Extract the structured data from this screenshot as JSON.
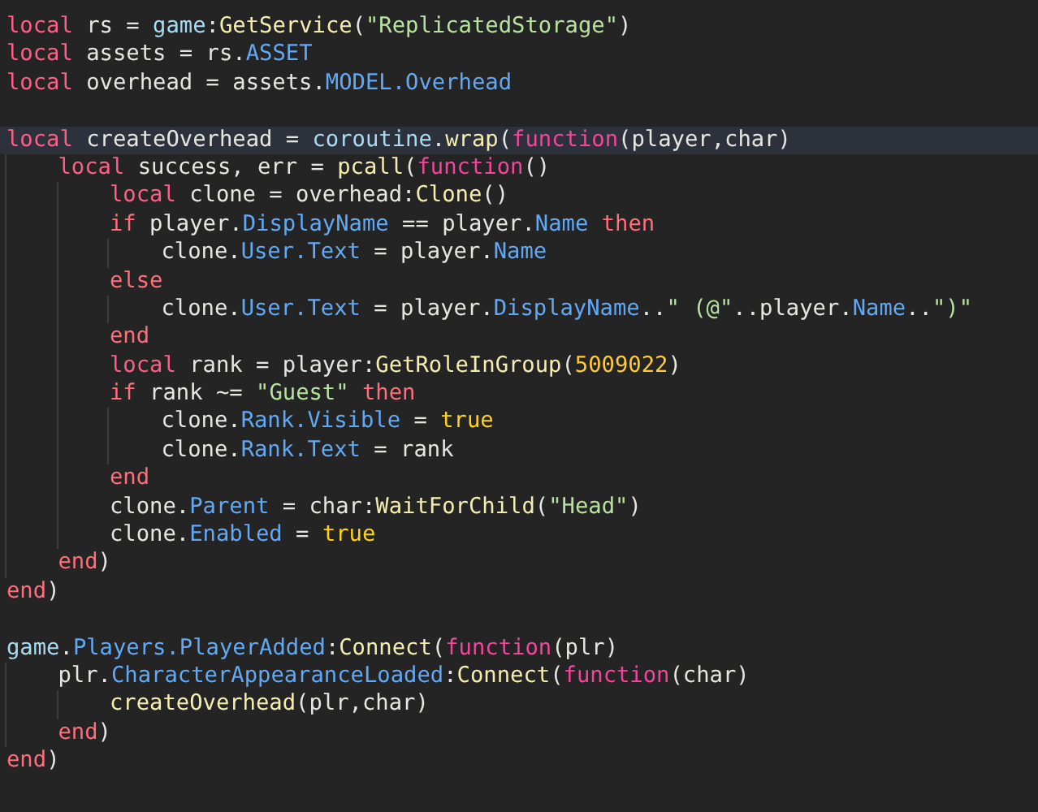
{
  "editor": {
    "lines": [
      {
        "kind": "code",
        "current": false,
        "tokens": [
          {
            "kind": "keyword",
            "text": "local"
          },
          {
            "kind": "plain",
            "text": " rs = "
          },
          {
            "kind": "global",
            "text": "game"
          },
          {
            "kind": "plain",
            "text": ":"
          },
          {
            "kind": "method",
            "text": "GetService"
          },
          {
            "kind": "plain",
            "text": "("
          },
          {
            "kind": "string",
            "text": "\"ReplicatedStorage\""
          },
          {
            "kind": "plain",
            "text": ")"
          }
        ]
      },
      {
        "kind": "code",
        "current": false,
        "tokens": [
          {
            "kind": "keyword",
            "text": "local"
          },
          {
            "kind": "plain",
            "text": " assets = rs."
          },
          {
            "kind": "property",
            "text": "ASSET"
          }
        ]
      },
      {
        "kind": "code",
        "current": false,
        "tokens": [
          {
            "kind": "keyword",
            "text": "local"
          },
          {
            "kind": "plain",
            "text": " overhead = assets."
          },
          {
            "kind": "property",
            "text": "MODEL.Overhead"
          }
        ]
      },
      {
        "kind": "blank",
        "current": false
      },
      {
        "kind": "code",
        "current": true,
        "tokens": [
          {
            "kind": "keyword",
            "text": "local"
          },
          {
            "kind": "plain",
            "text": " createOverhead = "
          },
          {
            "kind": "global",
            "text": "coroutine"
          },
          {
            "kind": "plain",
            "text": "."
          },
          {
            "kind": "method",
            "text": "wrap"
          },
          {
            "kind": "plain",
            "text": "("
          },
          {
            "kind": "function",
            "text": "function"
          },
          {
            "kind": "plain",
            "text": "(player,char)"
          }
        ],
        "children": [
          {
            "kind": "code",
            "current": false,
            "tokens": [
              {
                "kind": "keyword",
                "text": "local"
              },
              {
                "kind": "plain",
                "text": " success, err = "
              },
              {
                "kind": "method",
                "text": "pcall"
              },
              {
                "kind": "plain",
                "text": "("
              },
              {
                "kind": "function",
                "text": "function"
              },
              {
                "kind": "plain",
                "text": "()"
              }
            ],
            "children": [
              {
                "kind": "code",
                "current": false,
                "tokens": [
                  {
                    "kind": "keyword",
                    "text": "local"
                  },
                  {
                    "kind": "plain",
                    "text": " clone = overhead:"
                  },
                  {
                    "kind": "method",
                    "text": "Clone"
                  },
                  {
                    "kind": "plain",
                    "text": "()"
                  }
                ]
              },
              {
                "kind": "code",
                "current": false,
                "tokens": [
                  {
                    "kind": "control",
                    "text": "if"
                  },
                  {
                    "kind": "plain",
                    "text": " player."
                  },
                  {
                    "kind": "property",
                    "text": "DisplayName"
                  },
                  {
                    "kind": "plain",
                    "text": " == player."
                  },
                  {
                    "kind": "property",
                    "text": "Name"
                  },
                  {
                    "kind": "control",
                    "text": " then"
                  }
                ],
                "children": [
                  {
                    "kind": "code",
                    "current": false,
                    "tokens": [
                      {
                        "kind": "plain",
                        "text": "clone."
                      },
                      {
                        "kind": "property",
                        "text": "User.Text"
                      },
                      {
                        "kind": "plain",
                        "text": " = player."
                      },
                      {
                        "kind": "property",
                        "text": "Name"
                      }
                    ]
                  }
                ]
              },
              {
                "kind": "code",
                "current": false,
                "tokens": [
                  {
                    "kind": "control",
                    "text": "else"
                  }
                ],
                "children": [
                  {
                    "kind": "code",
                    "current": false,
                    "tokens": [
                      {
                        "kind": "plain",
                        "text": "clone."
                      },
                      {
                        "kind": "property",
                        "text": "User.Text"
                      },
                      {
                        "kind": "plain",
                        "text": " = player."
                      },
                      {
                        "kind": "property",
                        "text": "DisplayName"
                      },
                      {
                        "kind": "plain",
                        "text": ".."
                      },
                      {
                        "kind": "string",
                        "text": "\" (@\""
                      },
                      {
                        "kind": "plain",
                        "text": "..player."
                      },
                      {
                        "kind": "property",
                        "text": "Name"
                      },
                      {
                        "kind": "plain",
                        "text": ".."
                      },
                      {
                        "kind": "string",
                        "text": "\")\""
                      }
                    ]
                  }
                ]
              },
              {
                "kind": "code",
                "current": false,
                "tokens": [
                  {
                    "kind": "control",
                    "text": "end"
                  }
                ]
              },
              {
                "kind": "code",
                "current": false,
                "tokens": [
                  {
                    "kind": "keyword",
                    "text": "local"
                  },
                  {
                    "kind": "plain",
                    "text": " rank = player:"
                  },
                  {
                    "kind": "method",
                    "text": "GetRoleInGroup"
                  },
                  {
                    "kind": "plain",
                    "text": "("
                  },
                  {
                    "kind": "number",
                    "text": "5009022"
                  },
                  {
                    "kind": "plain",
                    "text": ")"
                  }
                ]
              },
              {
                "kind": "code",
                "current": false,
                "tokens": [
                  {
                    "kind": "control",
                    "text": "if"
                  },
                  {
                    "kind": "plain",
                    "text": " rank ~= "
                  },
                  {
                    "kind": "string",
                    "text": "\"Guest\""
                  },
                  {
                    "kind": "control",
                    "text": " then"
                  }
                ],
                "children": [
                  {
                    "kind": "code",
                    "current": false,
                    "tokens": [
                      {
                        "kind": "plain",
                        "text": "clone."
                      },
                      {
                        "kind": "property",
                        "text": "Rank.Visible"
                      },
                      {
                        "kind": "plain",
                        "text": " = "
                      },
                      {
                        "kind": "boolean",
                        "text": "true"
                      }
                    ]
                  },
                  {
                    "kind": "code",
                    "current": false,
                    "tokens": [
                      {
                        "kind": "plain",
                        "text": "clone."
                      },
                      {
                        "kind": "property",
                        "text": "Rank.Text"
                      },
                      {
                        "kind": "plain",
                        "text": " = rank"
                      }
                    ]
                  }
                ]
              },
              {
                "kind": "code",
                "current": false,
                "tokens": [
                  {
                    "kind": "control",
                    "text": "end"
                  }
                ]
              },
              {
                "kind": "code",
                "current": false,
                "tokens": [
                  {
                    "kind": "plain",
                    "text": "clone."
                  },
                  {
                    "kind": "property",
                    "text": "Parent"
                  },
                  {
                    "kind": "plain",
                    "text": " = char:"
                  },
                  {
                    "kind": "method",
                    "text": "WaitForChild"
                  },
                  {
                    "kind": "plain",
                    "text": "("
                  },
                  {
                    "kind": "string",
                    "text": "\"Head\""
                  },
                  {
                    "kind": "plain",
                    "text": ")"
                  }
                ]
              },
              {
                "kind": "code",
                "current": false,
                "tokens": [
                  {
                    "kind": "plain",
                    "text": "clone."
                  },
                  {
                    "kind": "property",
                    "text": "Enabled"
                  },
                  {
                    "kind": "plain",
                    "text": " = "
                  },
                  {
                    "kind": "boolean",
                    "text": "true"
                  }
                ]
              }
            ]
          },
          {
            "kind": "code",
            "current": false,
            "tokens": [
              {
                "kind": "control",
                "text": "end"
              },
              {
                "kind": "plain",
                "text": ")"
              }
            ]
          }
        ]
      },
      {
        "kind": "code",
        "current": false,
        "tokens": [
          {
            "kind": "control",
            "text": "end"
          },
          {
            "kind": "plain",
            "text": ")"
          }
        ]
      },
      {
        "kind": "blank",
        "current": false
      },
      {
        "kind": "code",
        "current": false,
        "tokens": [
          {
            "kind": "global",
            "text": "game"
          },
          {
            "kind": "plain",
            "text": "."
          },
          {
            "kind": "property",
            "text": "Players.PlayerAdded"
          },
          {
            "kind": "plain",
            "text": ":"
          },
          {
            "kind": "method",
            "text": "Connect"
          },
          {
            "kind": "plain",
            "text": "("
          },
          {
            "kind": "function",
            "text": "function"
          },
          {
            "kind": "plain",
            "text": "(plr)"
          }
        ],
        "children": [
          {
            "kind": "code",
            "current": false,
            "tokens": [
              {
                "kind": "plain",
                "text": "plr."
              },
              {
                "kind": "property",
                "text": "CharacterAppearanceLoaded"
              },
              {
                "kind": "plain",
                "text": ":"
              },
              {
                "kind": "method",
                "text": "Connect"
              },
              {
                "kind": "plain",
                "text": "("
              },
              {
                "kind": "function",
                "text": "function"
              },
              {
                "kind": "plain",
                "text": "(char)"
              }
            ],
            "children": [
              {
                "kind": "code",
                "current": false,
                "tokens": [
                  {
                    "kind": "method",
                    "text": "createOverhead"
                  },
                  {
                    "kind": "plain",
                    "text": "(plr,char)"
                  }
                ]
              }
            ]
          },
          {
            "kind": "code",
            "current": false,
            "tokens": [
              {
                "kind": "control",
                "text": "end"
              },
              {
                "kind": "plain",
                "text": ")"
              }
            ]
          }
        ]
      },
      {
        "kind": "code",
        "current": false,
        "tokens": [
          {
            "kind": "control",
            "text": "end"
          },
          {
            "kind": "plain",
            "text": ")"
          }
        ]
      }
    ]
  }
}
